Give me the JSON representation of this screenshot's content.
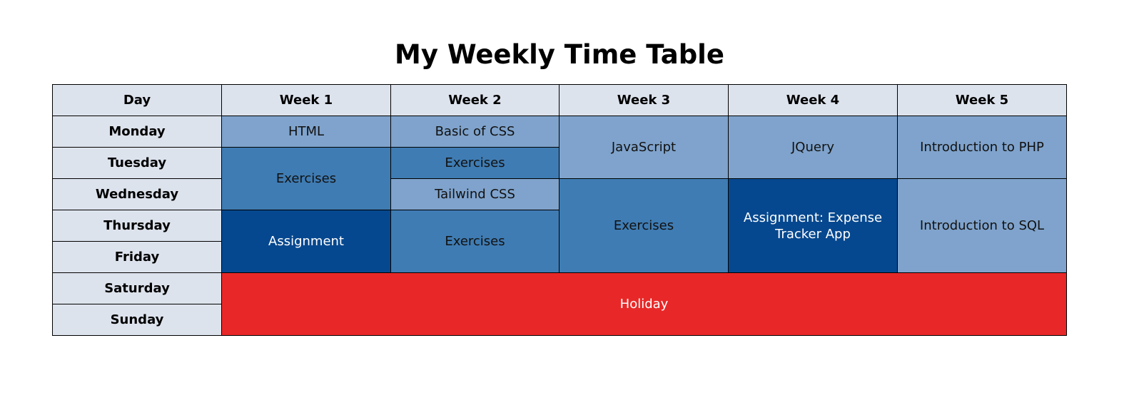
{
  "title": "My Weekly Time Table",
  "colors": {
    "header_bg": "#dde3ed",
    "light_blue": "#7fa3cc",
    "mid_blue": "#3f7cb3",
    "dark_blue": "#06488f",
    "holiday_red": "#e82828"
  },
  "header": {
    "day": "Day",
    "weeks": [
      "Week 1",
      "Week 2",
      "Week 3",
      "Week 4",
      "Week 5"
    ]
  },
  "days": [
    "Monday",
    "Tuesday",
    "Wednesday",
    "Thursday",
    "Friday",
    "Saturday",
    "Sunday"
  ],
  "entries": {
    "week1_monday": "HTML",
    "week1_tue_wed": "Exercises",
    "week1_thu_fri": "Assignment",
    "week2_monday": "Basic of CSS",
    "week2_tuesday": "Exercises",
    "week2_wednesday": "Tailwind CSS",
    "week2_thu_fri": "Exercises",
    "week3_mon_tue": "JavaScript",
    "week3_wed_fri": "Exercises",
    "week4_mon_tue": "JQuery",
    "week4_wed_fri": "Assignment: Expense Tracker App",
    "week5_mon_tue": "Introduction to PHP",
    "week5_wed_fri": "Introduction to SQL",
    "weekend": "Holiday"
  }
}
